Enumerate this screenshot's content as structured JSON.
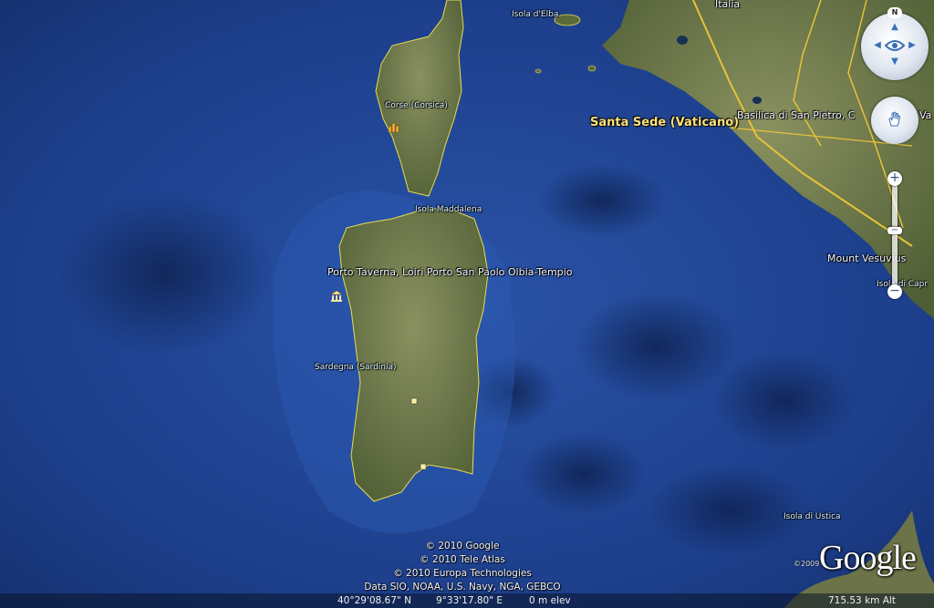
{
  "labels": {
    "italia": "Italia",
    "isola_elba": "Isola d'Elba",
    "corse": "Corse (Corsica)",
    "santa_sede": "Santa Sede (Vaticano)",
    "basilica": "Basilica di San Pietro, C",
    "basilica_end": "Va",
    "isola_maddalena": "Isola Maddalena",
    "porto_taverna": "Porto Taverna, Loiri Porto San Paolo Olbia-Tempio",
    "sardegna": "Sardegna (Sardinia)",
    "mount_vesuvius": "Mount Vesuvius",
    "isola_capri": "Isola di Capr",
    "isola_ustica": "Isola di Ustica"
  },
  "copyright": [
    "© 2010 Google",
    "© 2010 Tele Atlas",
    "© 2010 Europa Technologies",
    "Data SIO, NOAA, U.S. Navy, NGA, GEBCO"
  ],
  "logo": {
    "text": "Google",
    "year": "©2009"
  },
  "status": {
    "latitude": "40°29'08.67\" N",
    "longitude": "9°33'17.80\" E",
    "elevation": "0 m elev",
    "altitude": "715.53 km Alt"
  },
  "nav": {
    "north": "N",
    "zoom_in": "+",
    "zoom_out": "−"
  },
  "colors": {
    "sea": "#1c3f86",
    "land": "#6e7a4a",
    "border": "#f0e25a",
    "road": "#e6c23a"
  }
}
